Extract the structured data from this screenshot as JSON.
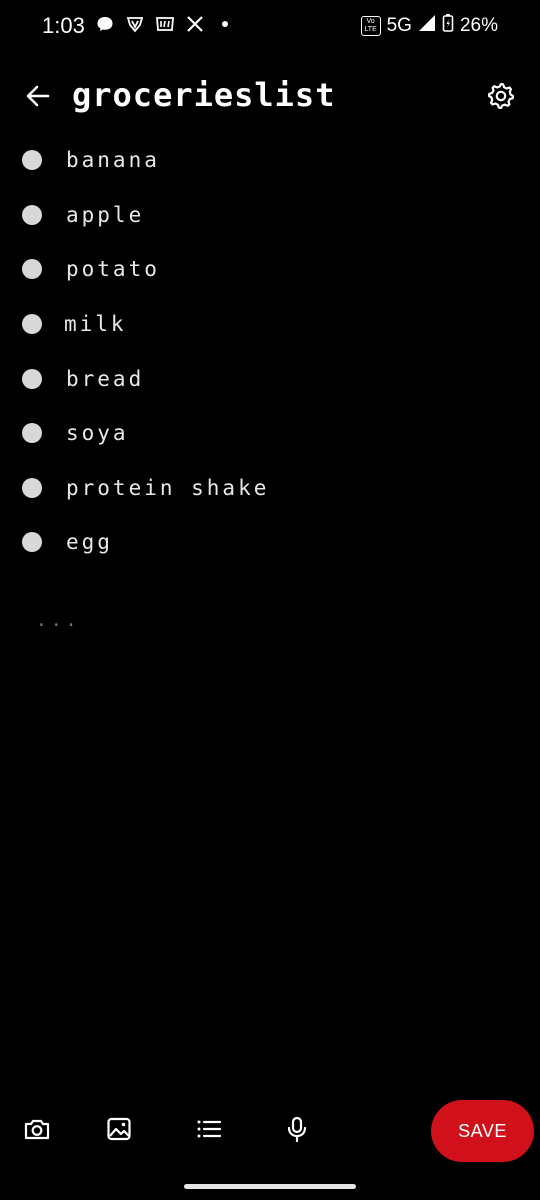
{
  "status_bar": {
    "time": "1:03",
    "network": "5G",
    "battery": "26%",
    "volte": "Vo LTE",
    "icons": [
      "chat-bubble-icon",
      "shield-v-icon",
      "app-icon",
      "x-icon",
      "dot-icon"
    ]
  },
  "header": {
    "title": "grocerieslist",
    "back_icon": "arrow-left-icon",
    "settings_icon": "gear-icon"
  },
  "list": {
    "items": [
      {
        "label": "banana"
      },
      {
        "label": "apple"
      },
      {
        "label": "potato"
      },
      {
        "label": "milk"
      },
      {
        "label": "bread"
      },
      {
        "label": "soya"
      },
      {
        "label": "protein shake"
      },
      {
        "label": "egg"
      }
    ],
    "more": "..."
  },
  "toolbar": {
    "icons": [
      "camera-icon",
      "image-icon",
      "list-icon",
      "microphone-icon"
    ],
    "save_label": "SAVE"
  },
  "colors": {
    "background": "#000000",
    "accent": "#d0101a",
    "bullet": "#d8d8d8"
  }
}
